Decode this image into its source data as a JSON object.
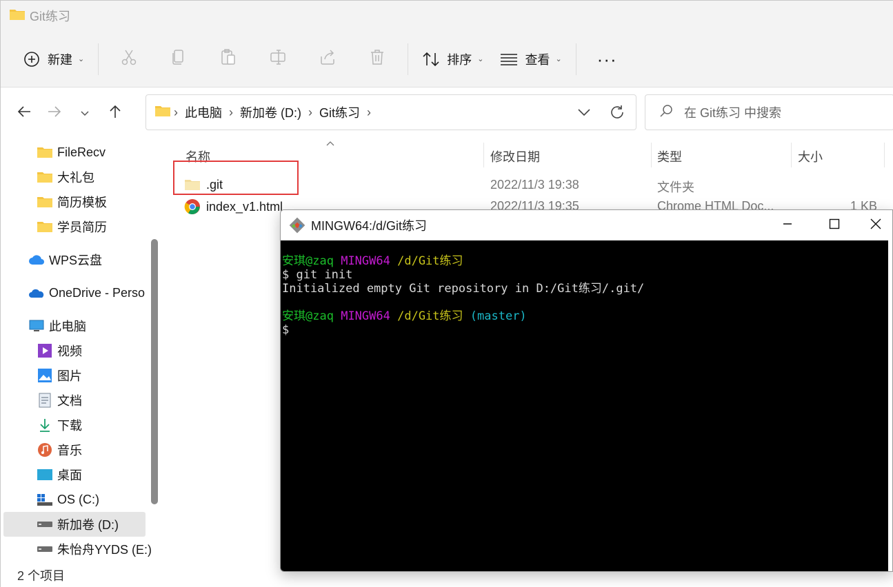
{
  "window": {
    "title": "Git练习"
  },
  "ribbon": {
    "new_label": "新建",
    "sort_label": "排序",
    "view_label": "查看",
    "more_label": "···",
    "icons": [
      "cut-icon",
      "copy-icon",
      "paste-icon",
      "rename-icon",
      "share-icon",
      "delete-icon"
    ]
  },
  "address": {
    "crumbs": [
      "此电脑",
      "新加卷 (D:)",
      "Git练习"
    ]
  },
  "search": {
    "placeholder": "在 Git练习 中搜索"
  },
  "sidebar": {
    "items": [
      {
        "label": "FileRecv",
        "icon": "folder-icon"
      },
      {
        "label": "大礼包",
        "icon": "folder-icon"
      },
      {
        "label": "简历模板",
        "icon": "folder-icon"
      },
      {
        "label": "学员简历",
        "icon": "folder-icon"
      },
      {
        "label": "WPS云盘",
        "icon": "cloud-icon"
      },
      {
        "label": "OneDrive - Perso",
        "icon": "onedrive-icon"
      },
      {
        "label": "此电脑",
        "icon": "pc-icon"
      },
      {
        "label": "视频",
        "icon": "video-icon"
      },
      {
        "label": "图片",
        "icon": "picture-icon"
      },
      {
        "label": "文档",
        "icon": "document-icon"
      },
      {
        "label": "下载",
        "icon": "download-icon"
      },
      {
        "label": "音乐",
        "icon": "music-icon"
      },
      {
        "label": "桌面",
        "icon": "desktop-icon"
      },
      {
        "label": "OS (C:)",
        "icon": "drive-c-icon"
      },
      {
        "label": "新加卷 (D:)",
        "icon": "drive-icon"
      },
      {
        "label": "朱怡舟YYDS (E:)",
        "icon": "drive-icon"
      }
    ]
  },
  "columns": {
    "name": "名称",
    "modified": "修改日期",
    "type": "类型",
    "size": "大小"
  },
  "files": [
    {
      "name": ".git",
      "modified": "2022/11/3 19:38",
      "type": "文件夹",
      "size": ""
    },
    {
      "name": "index_v1.html",
      "modified": "2022/11/3 19:35",
      "type": "Chrome HTML Doc...",
      "size": "1 KB"
    }
  ],
  "status": {
    "count": "2 个项目"
  },
  "terminal": {
    "title": "MINGW64:/d/Git练习",
    "lines": {
      "p1_user": "安琪@zaq",
      "p1_host": "MINGW64",
      "p1_path": "/d/Git练习",
      "cmd1": "$ git init",
      "out1": "Initialized empty Git repository in D:/Git练习/.git/",
      "p2_user": "安琪@zaq",
      "p2_host": "MINGW64",
      "p2_path": "/d/Git练习",
      "p2_branch": "(master)",
      "cmd2": "$"
    }
  },
  "colors": {
    "highlight_box": "#e23b3b",
    "prompt_user": "#1bbf2a",
    "prompt_host": "#c41bd1",
    "prompt_path": "#c7c31b",
    "prompt_branch": "#1bb7c7",
    "folder": "#f5c542"
  }
}
